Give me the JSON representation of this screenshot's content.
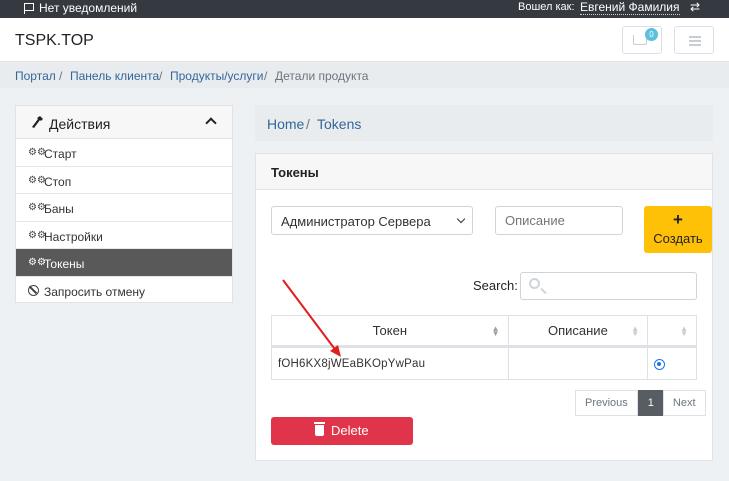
{
  "topbar": {
    "notifications": "Нет уведомлений",
    "logged_in_as": "Вошел как:",
    "user_name": "Евгений Фамилия"
  },
  "header": {
    "brand": "TSPK.TOP",
    "cart_count": "0"
  },
  "breadcrumb": {
    "items": [
      "Портал",
      "Панель клиента",
      "Продукты/услуги"
    ],
    "active": "Детали продукта",
    "separator": "/"
  },
  "sidebar": {
    "title": "Действия",
    "items": [
      {
        "label": "Старт",
        "icon": "gears-icon"
      },
      {
        "label": "Стоп",
        "icon": "gears-icon"
      },
      {
        "label": "Баны",
        "icon": "gears-icon"
      },
      {
        "label": "Настройки",
        "icon": "gears-icon"
      },
      {
        "label": "Токены",
        "icon": "gears-icon",
        "active": true
      },
      {
        "label": "Запросить отмену",
        "icon": "ban-icon"
      }
    ]
  },
  "inner_breadcrumb": {
    "home": "Home",
    "separator": "/",
    "current": "Tokens"
  },
  "tokens_panel": {
    "title": "Токены",
    "group_select": "Администратор Сервера",
    "description_placeholder": "Описание",
    "create_icon": "+",
    "create_label": "Создать",
    "search_label": "Search:",
    "table": {
      "columns": [
        "Токен",
        "Описание",
        ""
      ],
      "rows": [
        {
          "token": "fOH6KX8jWEaBKOpYwPau",
          "description": "",
          "selected": true
        }
      ]
    },
    "pagination": {
      "previous": "Previous",
      "current": "1",
      "next": "Next"
    },
    "delete_label": "Delete"
  },
  "colors": {
    "topbar_bg": "#343a40",
    "link": "#336699",
    "create_button": "#ffc107",
    "delete_button": "#e0344a",
    "active_sidebar": "#595959",
    "annotation_arrow": "#e02020"
  }
}
